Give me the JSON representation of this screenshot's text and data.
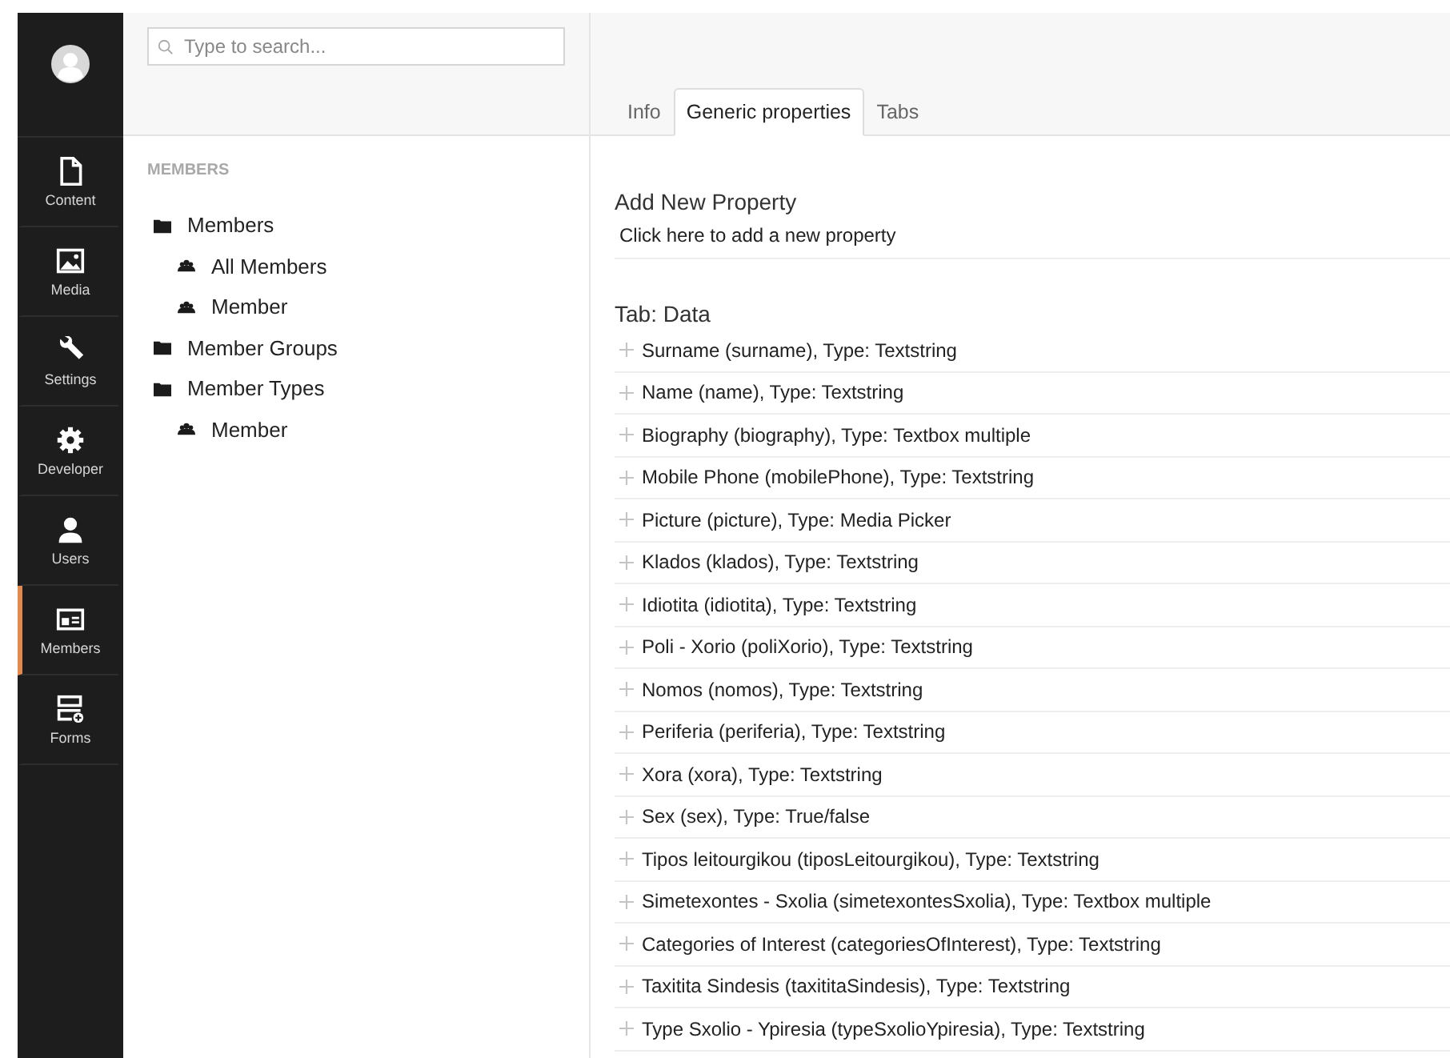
{
  "nav": [
    {
      "label": "Content",
      "kind": "page",
      "selected": false
    },
    {
      "label": "Media",
      "kind": "image",
      "selected": false
    },
    {
      "label": "Settings",
      "kind": "wrench",
      "selected": false
    },
    {
      "label": "Developer",
      "kind": "gear",
      "selected": false
    },
    {
      "label": "Users",
      "kind": "user",
      "selected": false
    },
    {
      "label": "Members",
      "kind": "card",
      "selected": true
    },
    {
      "label": "Forms",
      "kind": "forms",
      "selected": false
    }
  ],
  "search": {
    "placeholder": "Type to search..."
  },
  "tree": {
    "heading": "MEMBERS",
    "items": [
      {
        "label": "Members",
        "kind": "folder",
        "children": [
          {
            "label": "All Members",
            "kind": "member"
          },
          {
            "label": "Member",
            "kind": "member"
          }
        ]
      },
      {
        "label": "Member Groups",
        "kind": "folder"
      },
      {
        "label": "Member Types",
        "kind": "folder",
        "children": [
          {
            "label": "Member",
            "kind": "member"
          }
        ]
      }
    ]
  },
  "tabs": [
    {
      "label": "Info",
      "selected": false
    },
    {
      "label": "Generic properties",
      "selected": true
    },
    {
      "label": "Tabs",
      "selected": false
    }
  ],
  "add_property": {
    "title": "Add New Property",
    "link": "Click here to add a new property"
  },
  "group": {
    "title": "Tab: Data",
    "properties": [
      "Surname (surname), Type: Textstring",
      "Name (name), Type: Textstring",
      "Biography (biography), Type: Textbox multiple",
      "Mobile Phone (mobilePhone), Type: Textstring",
      "Picture (picture), Type: Media Picker",
      "Klados (klados), Type: Textstring",
      "Idiotita (idiotita), Type: Textstring",
      "Poli - Xorio (poliXorio), Type: Textstring",
      "Nomos (nomos), Type: Textstring",
      "Periferia (periferia), Type: Textstring",
      "Xora (xora), Type: Textstring",
      "Sex (sex), Type: True/false",
      "Tipos leitourgikou (tiposLeitourgikou), Type: Textstring",
      "Simetexontes - Sxolia (simetexontesSxolia), Type: Textbox multiple",
      "Categories of Interest (categoriesOfInterest), Type: Textstring",
      "Taxitita Sindesis (taxititaSindesis), Type: Textstring",
      "Type Sxolio - Ypiresia (typeSxolioYpiresia), Type: Textstring"
    ]
  }
}
